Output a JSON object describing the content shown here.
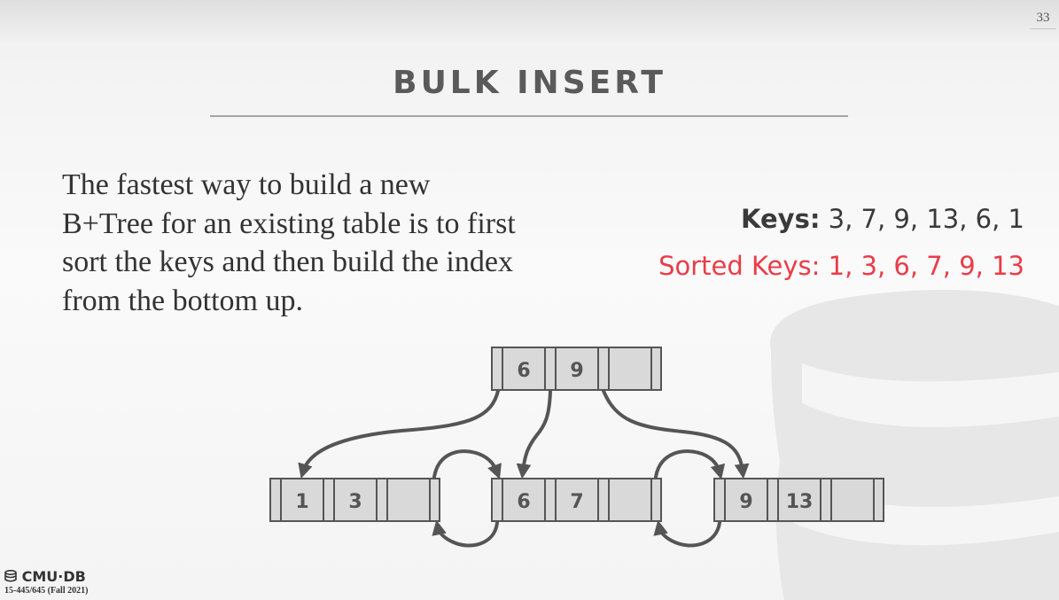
{
  "slide": {
    "number": "33",
    "title": "BULK INSERT",
    "body_lines": [
      "The fastest way to build a new",
      "B+Tree for an existing table is to first",
      "sort the keys and then build the index",
      "from the bottom up."
    ],
    "keys_label": "Keys:",
    "keys_values": " 3, 7, 9, 13, 6, 1",
    "sorted_keys": "Sorted Keys: 1, 3, 6, 7, 9, 13",
    "colors": {
      "accent_red": "#ea3c48",
      "title_gray": "#5a5a5a",
      "node_fill": "#d9d9d9",
      "node_stroke": "#555555"
    }
  },
  "tree": {
    "root": {
      "keys": [
        "6",
        "9",
        ""
      ]
    },
    "leaves": [
      {
        "keys": [
          "1",
          "3",
          ""
        ]
      },
      {
        "keys": [
          "6",
          "7",
          ""
        ]
      },
      {
        "keys": [
          "9",
          "13",
          ""
        ]
      }
    ]
  },
  "footer": {
    "logo_text": "CMU·DB",
    "course": "15-445/645 (Fall 2021)"
  }
}
